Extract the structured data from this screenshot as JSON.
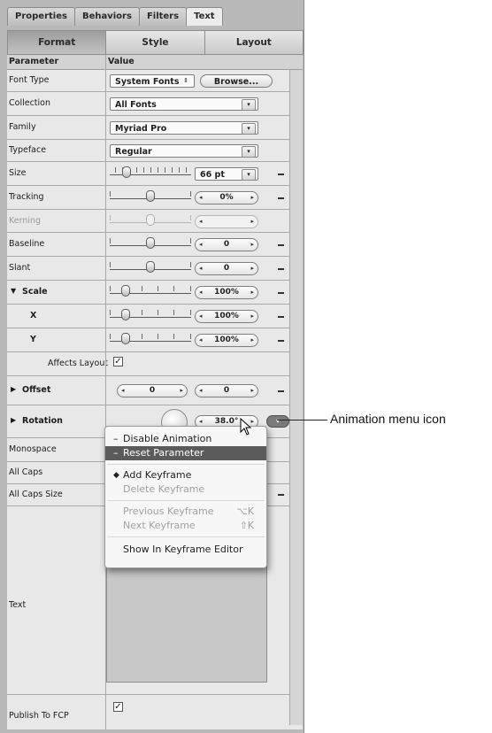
{
  "tabs": [
    "Properties",
    "Behaviors",
    "Filters",
    "Text"
  ],
  "segments": [
    "Format",
    "Style",
    "Layout"
  ],
  "header": {
    "parameter": "Parameter",
    "value": "Value"
  },
  "font_type": {
    "label": "Font Type",
    "value": "System Fonts",
    "browse": "Browse..."
  },
  "collection": {
    "label": "Collection",
    "value": "All Fonts"
  },
  "family": {
    "label": "Family",
    "value": "Myriad Pro"
  },
  "typeface": {
    "label": "Typeface",
    "value": "Regular"
  },
  "size": {
    "label": "Size",
    "value": "66 pt"
  },
  "tracking": {
    "label": "Tracking",
    "value": "0%"
  },
  "kerning": {
    "label": "Kerning"
  },
  "baseline": {
    "label": "Baseline",
    "value": "0"
  },
  "slant": {
    "label": "Slant",
    "value": "0"
  },
  "scale": {
    "label": "Scale",
    "value": "100%",
    "x_label": "X",
    "x_value": "100%",
    "y_label": "Y",
    "y_value": "100%"
  },
  "affects_layout": {
    "label": "Affects Layout",
    "checked": true
  },
  "offset": {
    "label": "Offset",
    "x": "0",
    "y": "0"
  },
  "rotation": {
    "label": "Rotation",
    "value": "38.0°"
  },
  "monospace": {
    "label": "Monospace"
  },
  "all_caps": {
    "label": "All Caps"
  },
  "all_caps_size": {
    "label": "All Caps Size"
  },
  "text_param": {
    "label": "Text"
  },
  "publish": {
    "label": "Publish To FCP",
    "checked": true
  },
  "menu": {
    "disable_animation": "Disable Animation",
    "reset_parameter": "Reset Parameter",
    "add_keyframe": "Add Keyframe",
    "delete_keyframe": "Delete Keyframe",
    "previous_keyframe": "Previous Keyframe",
    "previous_shortcut": "⌥K",
    "next_keyframe": "Next Keyframe",
    "next_shortcut": "⇧K",
    "show_in_editor": "Show In Keyframe Editor"
  },
  "callout": "Animation menu icon",
  "glyphs": {
    "tri_down": "▼",
    "tri_right": "▶",
    "arrow_down": "▾",
    "updown": "⇕",
    "left": "◂",
    "right": "▸",
    "check": "✓",
    "minus": "–",
    "diamond": "◆",
    "dash": "—"
  }
}
